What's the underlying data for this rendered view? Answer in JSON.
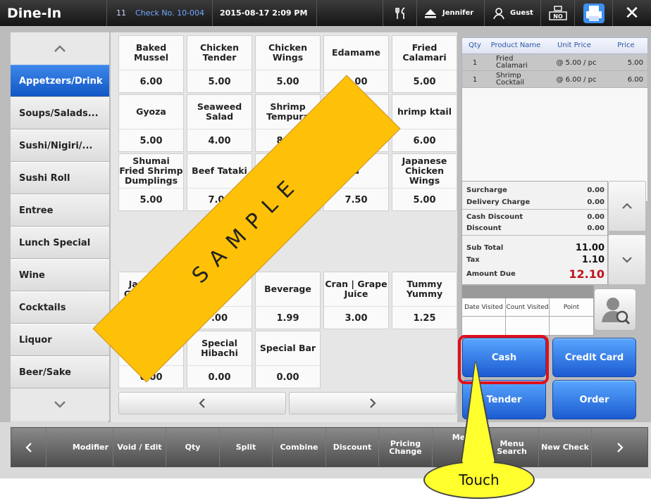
{
  "topbar": {
    "mode": "Dine-In",
    "table_no": "11",
    "check_no": "Check No. 10-004",
    "datetime": "2015-08-17   2:09 PM",
    "user": "Jennifer",
    "guest": "Guest"
  },
  "categories": [
    "Appetzers/Drink",
    "Soups/Salads...",
    "Sushi/Nigiri/...",
    "Sushi Roll",
    "Entree",
    "Lunch Special",
    "Wine",
    "Cocktails",
    "Liquor",
    "Beer/Sake"
  ],
  "menu_items": [
    {
      "name": "Baked Mussel",
      "price": "6.00"
    },
    {
      "name": "Chicken Tender",
      "price": "5.00"
    },
    {
      "name": "Chicken Wings",
      "price": "5.00"
    },
    {
      "name": "Edamame",
      "price": "3.00"
    },
    {
      "name": "Fried Calamari",
      "price": "5.00"
    },
    {
      "name": "Gyoza",
      "price": "5.00"
    },
    {
      "name": "Seaweed Salad",
      "price": "4.00"
    },
    {
      "name": "Shrimp Tempura",
      "price": "8.95"
    },
    {
      "name": "Shrim Te",
      "price": ""
    },
    {
      "name": "hrimp ktail",
      "price": "6.00"
    },
    {
      "name": "Shumai Fried Shrimp Dumplings",
      "price": "5.00"
    },
    {
      "name": "Beef Tataki",
      "price": "7.00"
    },
    {
      "name": "Tuna T",
      "price": ""
    },
    {
      "name": "d",
      "price": "7.50"
    },
    {
      "name": "Japanese Chicken Wings",
      "price": "5.00"
    },
    {
      "name": "Japanese Green T Po",
      "price": ""
    },
    {
      "name": "",
      "price": ".00"
    },
    {
      "name": "Beverage",
      "price": "1.99"
    },
    {
      "name": "Cran | Grape Juice",
      "price": "3.00"
    },
    {
      "name": "Tummy Yummy",
      "price": "1.25"
    },
    {
      "name": "Specia",
      "price": "0.00"
    },
    {
      "name": "Special Hibachi",
      "price": "0.00"
    },
    {
      "name": "Special Bar",
      "price": "0.00"
    }
  ],
  "order": {
    "headers": {
      "qty": "Qty",
      "product": "Product Name",
      "unit": "Unit Price",
      "price": "Price"
    },
    "rows": [
      {
        "qty": "1",
        "name": "Fried Calamari",
        "unit": "@ 5.00 / pc",
        "price": "5.00"
      },
      {
        "qty": "1",
        "name": "Shrimp Cocktail",
        "unit": "@ 6.00 / pc",
        "price": "6.00"
      }
    ]
  },
  "totals": {
    "surcharge_label": "Surcharge",
    "surcharge": "0.00",
    "delivery_label": "Delivery Charge",
    "delivery": "0.00",
    "cash_discount_label": "Cash Discount",
    "cash_discount": "0.00",
    "discount_label": "Discount",
    "discount": "0.00",
    "subtotal_label": "Sub Total",
    "subtotal": "11.00",
    "tax_label": "Tax",
    "tax": "1.10",
    "amount_due_label": "Amount Due",
    "amount_due": "12.10",
    "amount_due_color": "#c0141c"
  },
  "visits": {
    "date": "Date Visited",
    "count": "Count Visited",
    "point": "Point"
  },
  "payment": {
    "cash": "Cash",
    "credit": "Credit Card",
    "tender": "Tender",
    "order": "Order"
  },
  "bottom": {
    "modifier": "Modifier",
    "void_edit": "Void / Edit",
    "qty": "Qty",
    "split": "Split",
    "combine": "Combine",
    "discount": "Discount",
    "pricing_change": "Pricing Change",
    "me": "Me",
    "menu_search": "Menu Search",
    "new_check": "New Check"
  },
  "callout": "Touch",
  "watermark": "SAMPLE",
  "colors": {
    "accent": "#1c5bd1",
    "highlight": "#e0101a",
    "callout": "#ffff2e",
    "watermark": "#ffc107"
  }
}
